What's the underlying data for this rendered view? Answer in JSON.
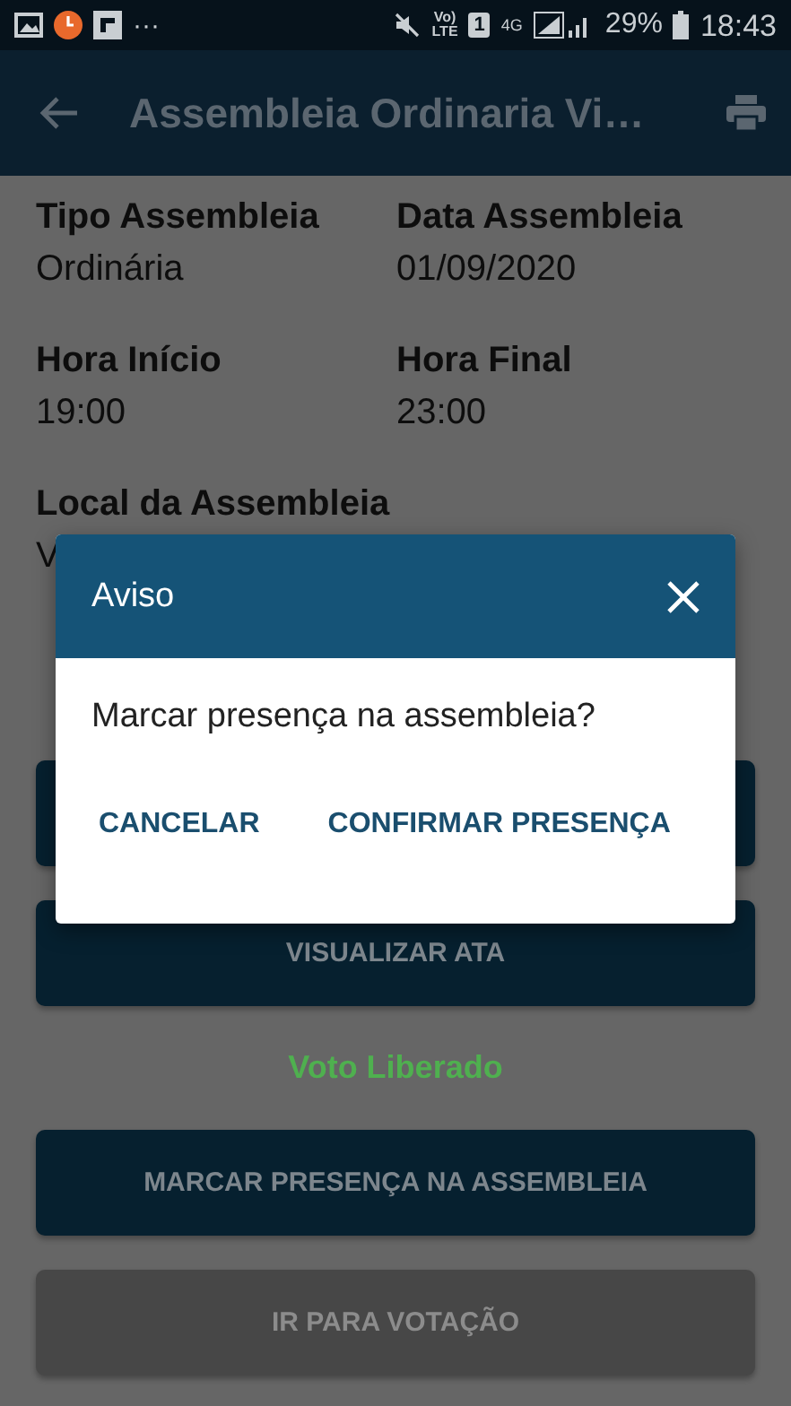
{
  "status_bar": {
    "overflow": "···",
    "volte_top": "Vo)",
    "volte_bottom": "LTE",
    "sim": "1",
    "network": "4G",
    "battery": "29%",
    "time": "18:43"
  },
  "app_bar": {
    "title": "Assembleia Ordinaria Vi…"
  },
  "field_rows": [
    [
      {
        "label": "Tipo Assembleia",
        "value": "Ordinária"
      },
      {
        "label": "Data Assembleia",
        "value": "01/09/2020"
      }
    ],
    [
      {
        "label": "Hora Início",
        "value": "19:00"
      },
      {
        "label": "Hora Final",
        "value": "23:00"
      }
    ],
    [
      {
        "label": "Local da Assembleia",
        "value": "V"
      }
    ]
  ],
  "buttons": [
    {
      "kind": "primary",
      "disabled": false
    },
    {
      "kind": "primary",
      "label": "VISUALIZAR ATA",
      "disabled": false
    },
    {
      "kind": "status",
      "label": "Voto Liberado"
    },
    {
      "kind": "primary",
      "label": "MARCAR PRESENÇA NA ASSEMBLEIA",
      "disabled": false
    },
    {
      "kind": "primary",
      "label": "IR PARA VOTAÇÃO",
      "disabled": true
    }
  ],
  "dialog": {
    "title": "Aviso",
    "message": "Marcar presença na assembleia?",
    "actions": [
      "CANCELAR",
      "CONFIRMAR PRESENÇA"
    ]
  }
}
